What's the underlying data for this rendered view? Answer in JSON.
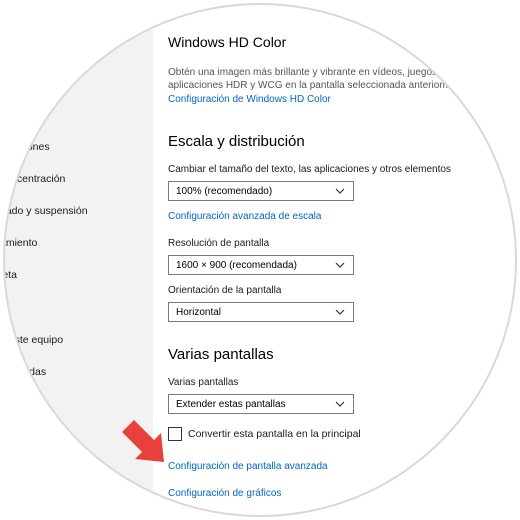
{
  "sidebar": {
    "items": [
      {
        "label": "y acciones"
      },
      {
        "label": "concentración"
      },
      {
        "label": "gado y suspensión"
      },
      {
        "label": "amiento"
      },
      {
        "label": "leta"
      },
      {
        "label": "n este equipo"
      },
      {
        "label": "mpartidas"
      }
    ]
  },
  "hd_color": {
    "title": "Windows HD Color",
    "desc_line1": "Obtén una imagen más brillante y vibrante en vídeos, juegos y",
    "desc_line2": "aplicaciones HDR y WCG en la pantalla seleccionada anteriorme",
    "link": "Configuración de Windows HD Color"
  },
  "scale": {
    "title": "Escala y distribución",
    "size_label": "Cambiar el tamaño del texto, las aplicaciones y otros elementos",
    "size_value": "100% (recomendado)",
    "advanced_link": "Configuración avanzada de escala",
    "resolution_label": "Resolución de pantalla",
    "resolution_value": "1600 × 900 (recomendada)",
    "orientation_label": "Orientación de la pantalla",
    "orientation_value": "Horizontal"
  },
  "multi": {
    "title": "Varias pantallas",
    "label": "Varias pantallas",
    "value": "Extender estas pantallas",
    "checkbox_label": "Convertir esta pantalla en la principal",
    "checkbox_checked": false,
    "advanced_display_link": "Configuración de pantalla avanzada",
    "graphics_link": "Configuración de gráficos"
  },
  "colors": {
    "accent": "#0067c0",
    "arrow": "#e8413c",
    "sidebar": "#f2f2f2"
  },
  "icons": {
    "dropdown": "chevron-down-icon",
    "arrow": "red-pointer-arrow-icon"
  }
}
